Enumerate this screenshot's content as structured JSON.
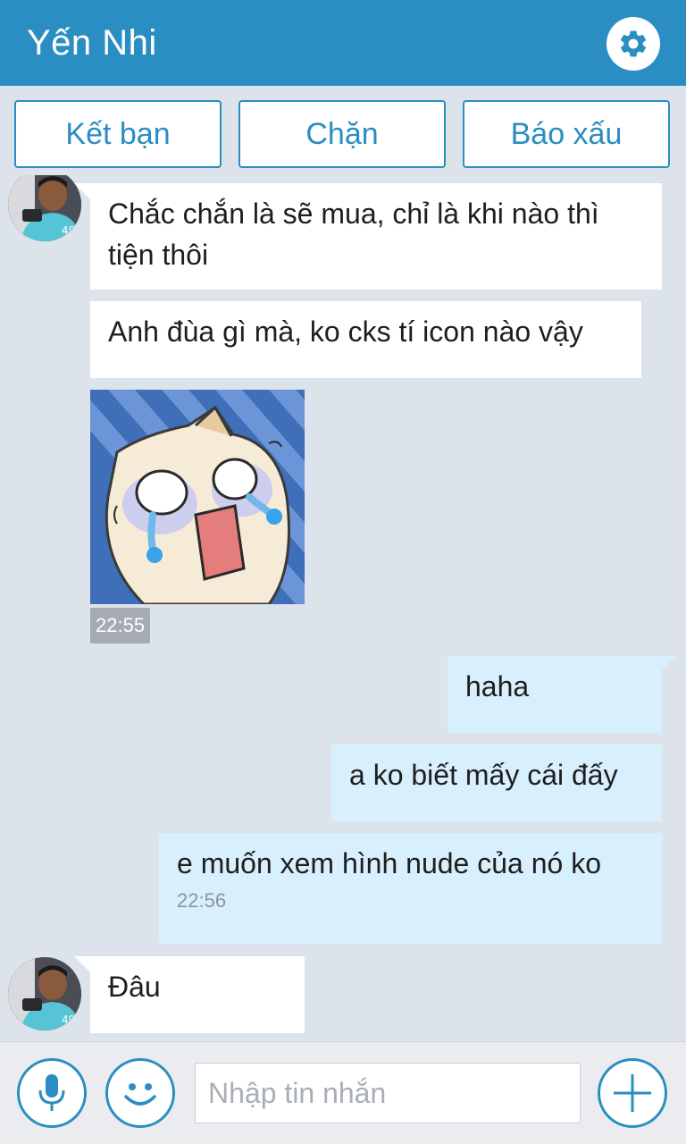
{
  "header": {
    "title": "Yến Nhi",
    "settings_icon": "gear-icon"
  },
  "actions": {
    "add_friend": "Kết bạn",
    "block": "Chặn",
    "report": "Báo xấu"
  },
  "messages": [
    {
      "direction": "incoming",
      "text": "Chắc chắn là sẽ mua, chỉ là khi nào thì tiện thôi"
    },
    {
      "direction": "incoming",
      "text": "Anh đùa gì mà, ko cks tí icon nào vậy"
    },
    {
      "direction": "incoming",
      "type": "sticker",
      "sticker": "crying-cat-sticker",
      "time": "22:55"
    },
    {
      "direction": "outgoing",
      "text": "haha"
    },
    {
      "direction": "outgoing",
      "text": "a ko biết mấy cái đấy"
    },
    {
      "direction": "outgoing",
      "text": "e muốn xem hình nude của nó ko",
      "time": "22:56"
    },
    {
      "direction": "incoming",
      "text": "Đâu"
    }
  ],
  "input_bar": {
    "placeholder": "Nhập tin nhắn",
    "mic_icon": "microphone-icon",
    "emoji_icon": "smiley-icon",
    "attach_icon": "plus-icon"
  },
  "colors": {
    "accent": "#2a8ec2",
    "chat_background": "#dde3ea",
    "incoming_bubble": "#ffffff",
    "outgoing_bubble": "#d8f0fd"
  }
}
